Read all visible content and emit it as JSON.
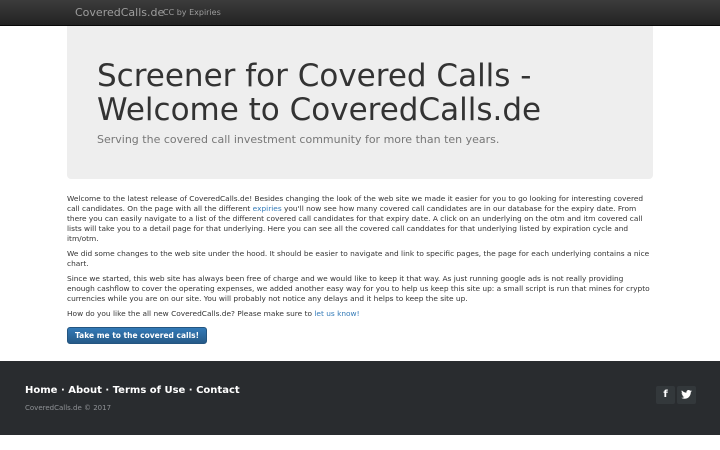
{
  "navbar": {
    "brand": "CoveredCalls.de",
    "link": "CC by Expiries"
  },
  "jumbotron": {
    "title": "Screener for Covered Calls - Welcome to CoveredCalls.de",
    "lead": "Serving the covered call investment community for more than ten years."
  },
  "content": {
    "p1_a": "Welcome to the latest release of CoveredCalls.de! Besides changing the look of the web site we made it easier for you to go looking for interesting covered call candidates. On the page with all the different ",
    "p1_link": "expiries",
    "p1_b": " you'll now see how many covered call candidates are in our database for the expiry date. From there you can easily navigate to a list of the different covered call candidates for that expiry date. A click on an underlying on the otm and itm covered call lists will take you to a detail page for that underlying. Here you can see all the covered call canddates for that underlying listed by expiration cycle and itm/otm.",
    "p2": "We did some changes to the web site under the hood. It should be easier to navigate and link to specific pages, the page for each underlying contains a nice chart.",
    "p3": "Since we started, this web site has always been free of charge and we would like to keep it that way. As just running google ads is not really providing enough cashflow to cover the operating expenses, we added another easy way for you to help us keep this site up: a small script is run that mines for crypto currencies while you are on our site. You will probably not notice any delays and it helps to keep the site up.",
    "p4_a": "How do you like the all new CoveredCalls.de? Please make sure to ",
    "p4_link": "let us know!",
    "button": "Take me to the covered calls!"
  },
  "footer": {
    "links": [
      "Home",
      "About",
      "Terms of Use",
      "Contact"
    ],
    "separator": "·",
    "copyright": "CoveredCalls.de © 2017",
    "social": [
      {
        "icon": "facebook-icon",
        "glyph": "f"
      },
      {
        "icon": "twitter-icon",
        "glyph": "t"
      }
    ]
  }
}
